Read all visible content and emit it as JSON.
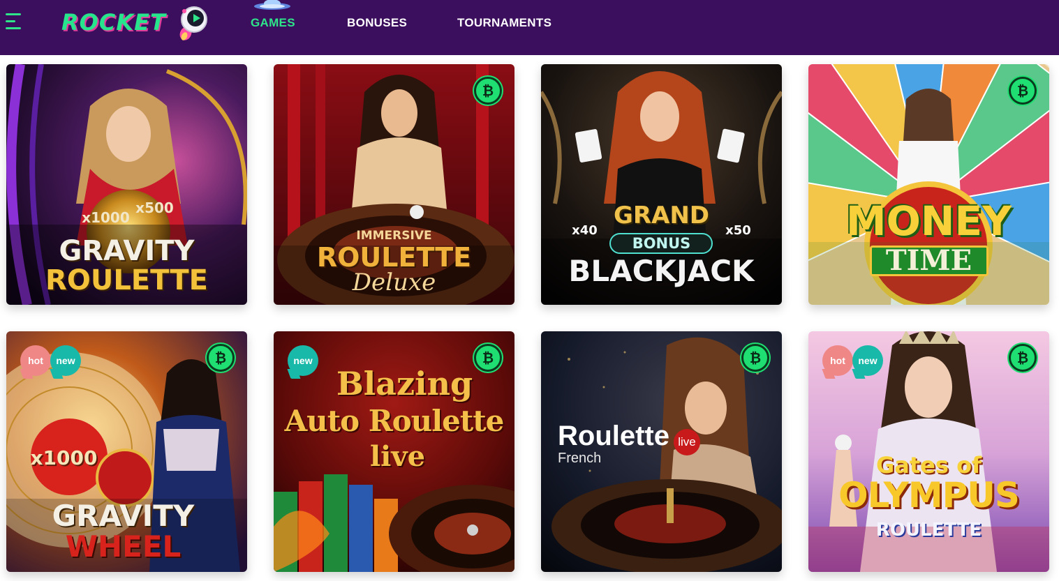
{
  "brand": {
    "name": "ROCKET"
  },
  "nav": [
    {
      "label": "GAMES",
      "active": true
    },
    {
      "label": "BONUSES",
      "active": false
    },
    {
      "label": "TOURNAMENTS",
      "active": false
    }
  ],
  "colors": {
    "header_bg": "#3b0f5e",
    "accent_green": "#2ee58a",
    "hot_tag": "#ef8787",
    "new_tag": "#18b9a8",
    "btc_badge": "#1fdf72"
  },
  "icons": {
    "menu": "hamburger-menu-icon",
    "crypto": "bitcoin-icon"
  },
  "games": [
    {
      "id": "gravity-roulette",
      "lines": [
        "x1000",
        "x500",
        "GRAVITY",
        "ROULETTE"
      ],
      "tags": [],
      "crypto": false
    },
    {
      "id": "immersive-roulette-deluxe",
      "lines": [
        "IMMERSIVE",
        "ROULETTE",
        "Deluxe"
      ],
      "tags": [],
      "crypto": true
    },
    {
      "id": "grand-bonus-blackjack",
      "lines": [
        "GRAND",
        "BONUS",
        "BLACKJACK",
        "x40",
        "x50"
      ],
      "tags": [],
      "crypto": false
    },
    {
      "id": "money-time",
      "lines": [
        "MONEY",
        "TIME"
      ],
      "tags": [],
      "crypto": true
    },
    {
      "id": "gravity-wheel",
      "lines": [
        "x1000",
        "GRAVITY",
        "WHEEL"
      ],
      "tags": [
        "hot",
        "new"
      ],
      "crypto": true
    },
    {
      "id": "blazing-auto-roulette-live",
      "lines": [
        "Blazing",
        "Auto Roulette",
        "live"
      ],
      "tags": [
        "new"
      ],
      "crypto": true
    },
    {
      "id": "roulette-live-french",
      "lines": [
        "Roulette",
        "live",
        "French"
      ],
      "tags": [],
      "crypto": true
    },
    {
      "id": "gates-of-olympus-roulette",
      "lines": [
        "Gates of",
        "OLYMPUS",
        "ROULETTE"
      ],
      "tags": [
        "hot",
        "new"
      ],
      "crypto": true
    }
  ]
}
